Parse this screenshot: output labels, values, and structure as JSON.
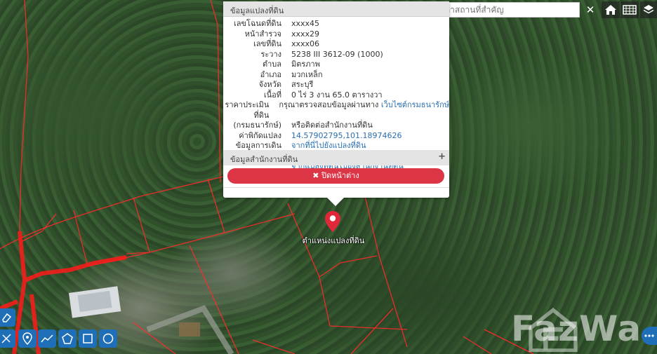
{
  "search": {
    "placeholder": "ค้นหาสถานที่สำคัญ",
    "clear_label": "✕"
  },
  "popup": {
    "header": "ข้อมูลแปลงที่ดิน",
    "rows": [
      {
        "label": "เลขโฉนดที่ดิน",
        "value": "xxxx45"
      },
      {
        "label": "หน้าสำรวจ",
        "value": "xxxx29"
      },
      {
        "label": "เลขที่ดิน",
        "value": "xxxx06"
      },
      {
        "label": "ระวาง",
        "value": "5238 III 3612-09 (1000)"
      },
      {
        "label": "ตำบล",
        "value": "มิตรภาพ"
      },
      {
        "label": "อำเภอ",
        "value": "มวกเหล็ก"
      },
      {
        "label": "จังหวัด",
        "value": "สระบุรี"
      },
      {
        "label": "เนื้อที่",
        "value": "0 ไร่ 3 งาน 65.0 ตารางวา"
      }
    ],
    "price_label": "ราคาประเมินที่ดิน",
    "price_label_2": "(กรมธนารักษ์)",
    "price_text": "กรุณาตรวจสอบข้อมูลผ่านทาง",
    "price_link": "เว็บไซต์กรมธนารักษ์",
    "price_text_2": "หรือติดต่อสำนักงานที่ดิน",
    "coord_label": "ค่าพิกัดแปลง",
    "coord_value": "14.57902795,101.18974626",
    "travel_label": "ข้อมูลการเดินทาง",
    "travel_link_1": "จากที่นี่ไปยังแปลงที่ดิน",
    "travel_link_2": "จากแปลงที่ดินไปยังสำนักงานที่ดิน",
    "office_header": "ข้อมูลสำนักงานที่ดิน",
    "office_plus": "+",
    "close_label": "✖ ปิดหน้าต่าง"
  },
  "marker": {
    "label": "ตำแหน่งแปลงที่ดิน"
  },
  "watermark": {
    "text": "FazWa"
  },
  "colors": {
    "accent_red": "#dc3545",
    "link_blue": "#2a6fb0",
    "tool_blue": "#1e6fb8",
    "parcel_line": "#ff2a2a"
  },
  "icons": [
    "home-icon",
    "grid-icon",
    "layers-icon",
    "eraser-icon",
    "ruler-icon",
    "pin-icon",
    "line-icon",
    "polygon-icon",
    "rectangle-icon",
    "circle-icon",
    "more-icon"
  ]
}
